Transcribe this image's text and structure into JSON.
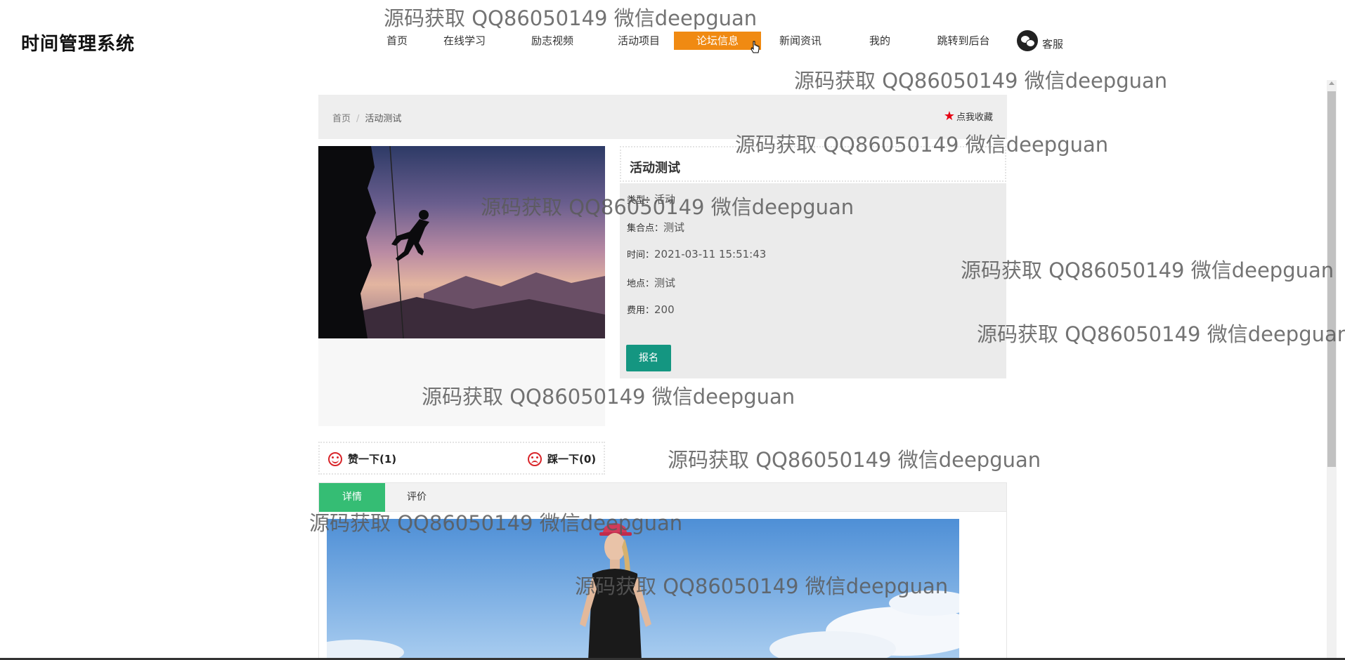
{
  "header": {
    "site_title": "时间管理系统",
    "nav": [
      {
        "label": "首页",
        "active": false
      },
      {
        "label": "在线学习",
        "active": false
      },
      {
        "label": "励志视频",
        "active": false
      },
      {
        "label": "活动项目",
        "active": false
      },
      {
        "label": "论坛信息",
        "active": true
      },
      {
        "label": "新闻资讯",
        "active": false
      },
      {
        "label": "我的",
        "active": false
      },
      {
        "label": "跳转到后台",
        "active": false
      }
    ],
    "service_icon": "wechat-icon",
    "service_label": "客服"
  },
  "breadcrumb": {
    "home": "首页",
    "separator": "/",
    "current": "活动测试",
    "favorite_label": "点我收藏",
    "favorite_icon": "star-icon"
  },
  "activity": {
    "title": "活动测试",
    "fields": [
      {
        "label": "类型：",
        "value": "活动"
      },
      {
        "label": "集合点：",
        "value": "测试"
      },
      {
        "label": "时间：",
        "value": "2021-03-11 15:51:43"
      },
      {
        "label": "地点：",
        "value": "测试"
      },
      {
        "label": "费用：",
        "value": "200"
      }
    ],
    "signup_label": "报名"
  },
  "votes": {
    "like_label": "赞一下(1)",
    "dislike_label": "踩一下(0)",
    "like_icon": "smile-icon",
    "dislike_icon": "sad-icon"
  },
  "tabs": {
    "active_label": "详情",
    "other_label": "评价"
  },
  "watermark": "源码获取 QQ86050149 微信deepguan",
  "colors": {
    "nav_active": "#f08a12",
    "signup_button": "#149681",
    "tab_active": "#35bd74",
    "icon_red": "#d9252a"
  }
}
